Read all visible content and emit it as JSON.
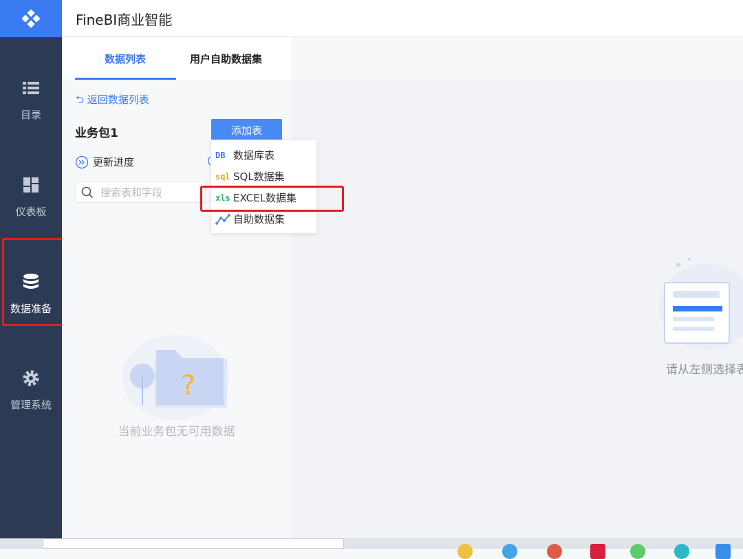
{
  "app": {
    "title": "FineBI商业智能"
  },
  "nav": {
    "items": [
      {
        "label": "目录",
        "icon": "list-icon"
      },
      {
        "label": "仪表板",
        "icon": "dashboard-grid-icon"
      },
      {
        "label": "数据准备",
        "icon": "database-icon",
        "active": true
      },
      {
        "label": "管理系统",
        "icon": "gear-icon"
      }
    ]
  },
  "panel": {
    "tabs": [
      "数据列表",
      "用户自助数据集"
    ],
    "back_label": "返回数据列表",
    "package_name": "业务包1",
    "add_table_label": "添加表",
    "update_label": "更新进度",
    "search_placeholder": "搜索表和字段",
    "empty_text": "当前业务包无可用数据"
  },
  "dropdown": {
    "items": [
      {
        "icon_text": "DB",
        "label": "数据库表",
        "color": "#3b7bf2"
      },
      {
        "icon_text": "sql",
        "label": "SQL数据集",
        "color": "#f0a21b"
      },
      {
        "icon_text": "xls",
        "label": "EXCEL数据集",
        "color": "#2fb36b"
      },
      {
        "icon_text": "",
        "label": "自助数据集",
        "color": "#3b7bf2"
      }
    ]
  },
  "main": {
    "hint_text": "请从左侧选择表"
  },
  "colors": {
    "accent": "#3b7bf2",
    "nav_bg": "#2d3a55",
    "highlight": "#e31e1e"
  }
}
